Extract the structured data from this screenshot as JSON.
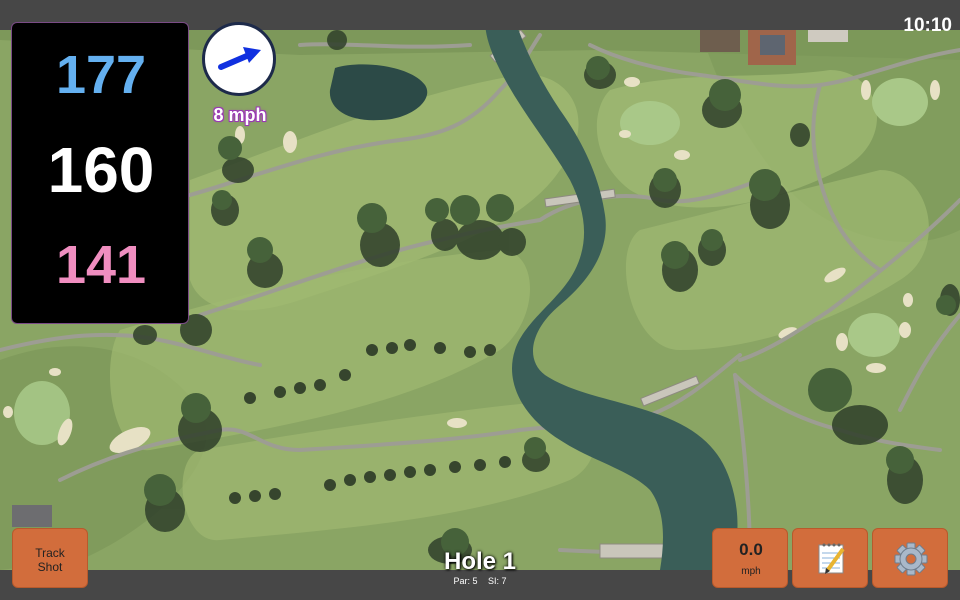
{
  "status": {
    "time": "10:10"
  },
  "distances": {
    "back": "177",
    "center": "160",
    "front": "141"
  },
  "wind": {
    "speed_label": "8 mph",
    "direction_icon": "arrow-up-right-icon"
  },
  "hole": {
    "title": "Hole 1",
    "par_label": "Par: 5",
    "si_label": "SI: 7"
  },
  "buttons": {
    "track_shot_line1": "Track",
    "track_shot_line2": "Shot",
    "speed_value": "0.0",
    "speed_unit": "mph",
    "notes_icon": "notepad-icon",
    "settings_icon": "gear-icon"
  },
  "map": {
    "type": "satellite-golf-course"
  },
  "colors": {
    "back_distance": "#64b0f0",
    "center_distance": "#ffffff",
    "front_distance": "#f08ec0",
    "button_orange": "#d26d3c",
    "wind_outline": "#9a37b4"
  }
}
